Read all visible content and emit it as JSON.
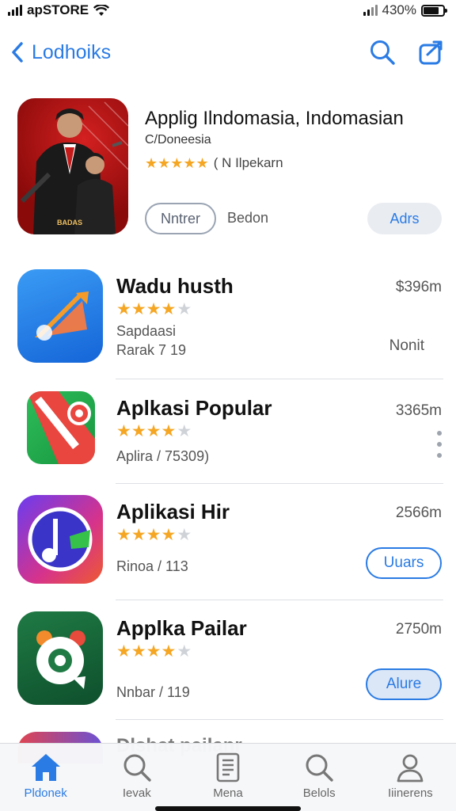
{
  "status": {
    "carrier": "apSTORE",
    "battery_pct": "430%"
  },
  "nav": {
    "back_label": "Lodhoiks"
  },
  "featured": {
    "title": "Applig Ilndomasia, Indomasian",
    "subtitle": "C/Doneesia",
    "rating_text": "( N Ilpekarn",
    "btn_outline": "Nntrer",
    "extra_label": "Bedon",
    "btn_get": "Adrs",
    "icon_caption": "BADAS"
  },
  "apps": [
    {
      "name": "Wadu husth",
      "stars": 4,
      "meta1": "Sapdaasi",
      "meta2": "Rarak 7 19",
      "size": "$396m",
      "side": "Nonit"
    },
    {
      "name": "Aplkasi Popular",
      "stars": 4,
      "meta1": "Aplira / 75309)",
      "meta2": "",
      "size": "3365m"
    },
    {
      "name": "Aplikasi Hir",
      "stars": 4,
      "meta1": "",
      "meta2": "Rinoa / 113",
      "size": "2566m",
      "button": "Uuars"
    },
    {
      "name": "Applka Pailar",
      "stars": 4,
      "meta1": "",
      "meta2": "Nnbar / 119",
      "size": "2750m",
      "button": "Alure"
    }
  ],
  "partial_row": {
    "name": "Dlshat pailanr"
  },
  "tabs": [
    {
      "label": "Pldonek",
      "icon": "home-icon",
      "active": true
    },
    {
      "label": "Ievak",
      "icon": "search-icon"
    },
    {
      "label": "Mena",
      "icon": "document-icon"
    },
    {
      "label": "Belols",
      "icon": "search-icon"
    },
    {
      "label": "Iiinerens",
      "icon": "person-icon"
    }
  ],
  "colors": {
    "accent": "#2a7be4",
    "star": "#f5a623"
  }
}
